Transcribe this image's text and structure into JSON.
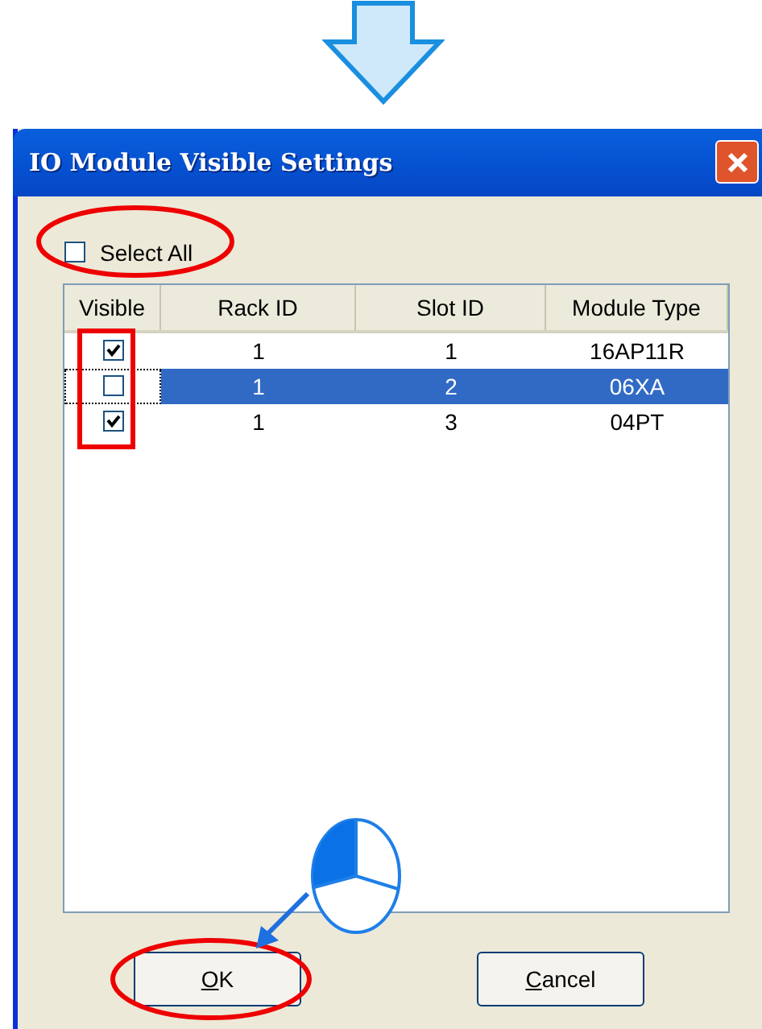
{
  "window": {
    "title": "IO Module Visible Settings"
  },
  "select_all": {
    "label": "Select All",
    "checked": false
  },
  "table": {
    "columns": [
      "Visible",
      "Rack ID",
      "Slot ID",
      "Module Type"
    ],
    "rows": [
      {
        "visible": true,
        "rack_id": "1",
        "slot_id": "1",
        "module_type": "16AP11R",
        "selected": false
      },
      {
        "visible": false,
        "rack_id": "1",
        "slot_id": "2",
        "module_type": "06XA",
        "selected": true
      },
      {
        "visible": true,
        "rack_id": "1",
        "slot_id": "3",
        "module_type": "04PT",
        "selected": false
      }
    ]
  },
  "buttons": [
    {
      "label": "OK"
    },
    {
      "label": "Cancel"
    }
  ]
}
